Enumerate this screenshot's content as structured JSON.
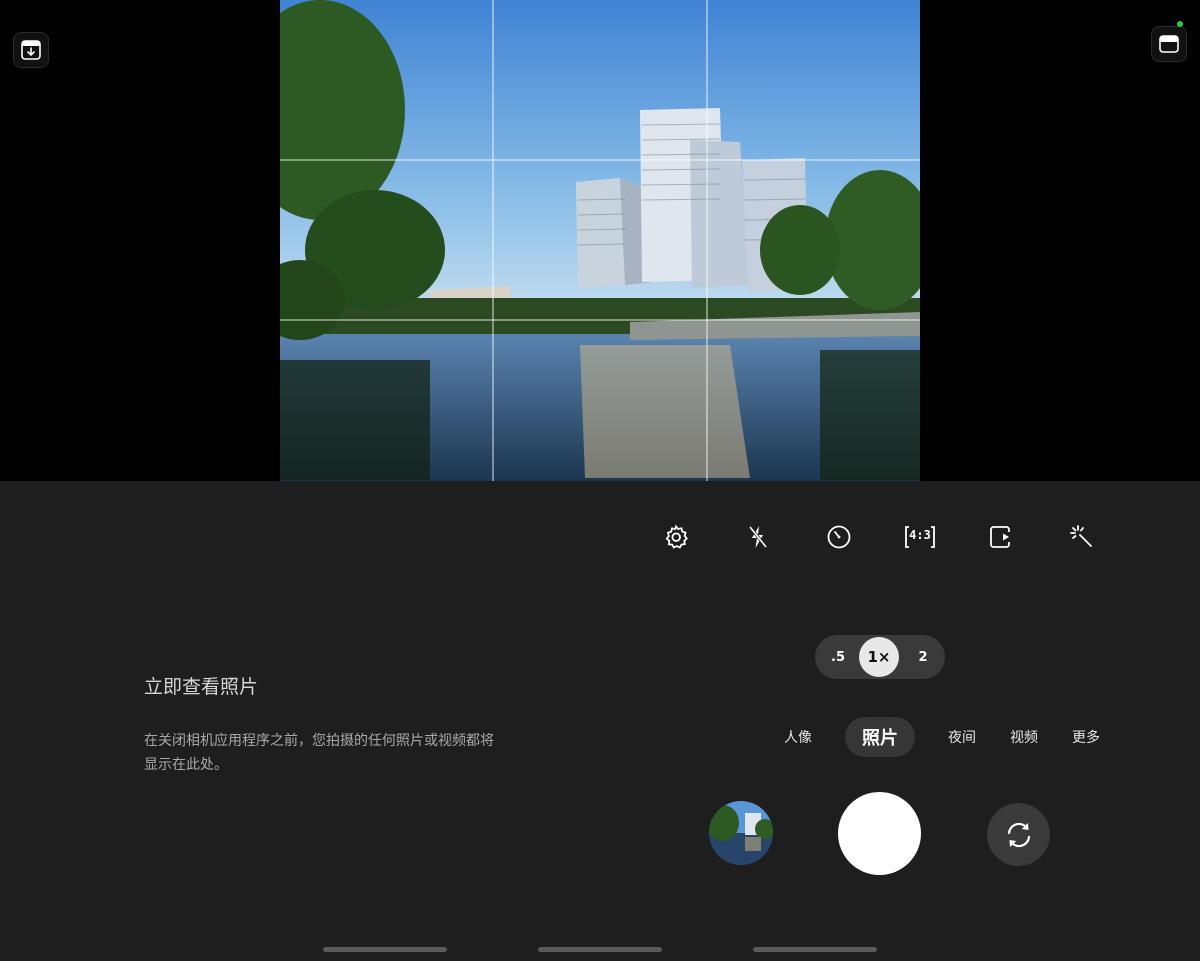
{
  "camera": {
    "gallery_tip": {
      "title": "立即查看照片",
      "body": "在关闭相机应用程序之前，您拍摄的任何照片或视频都将显示在此处。"
    },
    "toolbar": {
      "icons": [
        "settings-icon",
        "flash-off-icon",
        "timer-icon",
        "aspect-ratio-icon",
        "motion-photo-icon",
        "filters-icon"
      ],
      "aspect_label": "4:3"
    },
    "zoom": {
      "options": [
        ".5",
        "1×",
        "2"
      ],
      "selected": "1×"
    },
    "modes": {
      "items": [
        "人像",
        "照片",
        "夜间",
        "视频",
        "更多"
      ],
      "selected": "照片"
    },
    "colors": {
      "panel": "#1e1e1e",
      "accent_dot": "#2ecc40"
    }
  }
}
